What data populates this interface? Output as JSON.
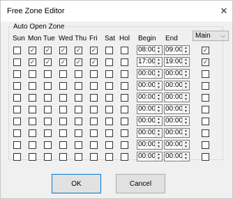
{
  "window": {
    "title": "Free Zone Editor"
  },
  "group": {
    "label": "Auto Open Zone"
  },
  "columns": [
    "Sun",
    "Mon",
    "Tue",
    "Wed",
    "Thu",
    "Fri",
    "Sat",
    "Hol",
    "Begin",
    "End"
  ],
  "mode_select": {
    "value": "Main"
  },
  "rows": [
    {
      "days": [
        false,
        true,
        true,
        true,
        true,
        true,
        false,
        false
      ],
      "begin": "08:00",
      "end": "09:00",
      "enabled": true
    },
    {
      "days": [
        false,
        true,
        true,
        true,
        true,
        true,
        false,
        false
      ],
      "begin": "17:00",
      "end": "19:00",
      "enabled": true
    },
    {
      "days": [
        false,
        false,
        false,
        false,
        false,
        false,
        false,
        false
      ],
      "begin": "00:00",
      "end": "00:00",
      "enabled": false
    },
    {
      "days": [
        false,
        false,
        false,
        false,
        false,
        false,
        false,
        false
      ],
      "begin": "00:00",
      "end": "00:00",
      "enabled": false
    },
    {
      "days": [
        false,
        false,
        false,
        false,
        false,
        false,
        false,
        false
      ],
      "begin": "00:00",
      "end": "00:00",
      "enabled": false
    },
    {
      "days": [
        false,
        false,
        false,
        false,
        false,
        false,
        false,
        false
      ],
      "begin": "00:00",
      "end": "00:00",
      "enabled": false
    },
    {
      "days": [
        false,
        false,
        false,
        false,
        false,
        false,
        false,
        false
      ],
      "begin": "00:00",
      "end": "00:00",
      "enabled": false
    },
    {
      "days": [
        false,
        false,
        false,
        false,
        false,
        false,
        false,
        false
      ],
      "begin": "00:00",
      "end": "00:00",
      "enabled": false
    },
    {
      "days": [
        false,
        false,
        false,
        false,
        false,
        false,
        false,
        false
      ],
      "begin": "00:00",
      "end": "00:00",
      "enabled": false
    },
    {
      "days": [
        false,
        false,
        false,
        false,
        false,
        false,
        false,
        false
      ],
      "begin": "00:00",
      "end": "00:00",
      "enabled": false
    }
  ],
  "buttons": {
    "ok": "OK",
    "cancel": "Cancel"
  }
}
